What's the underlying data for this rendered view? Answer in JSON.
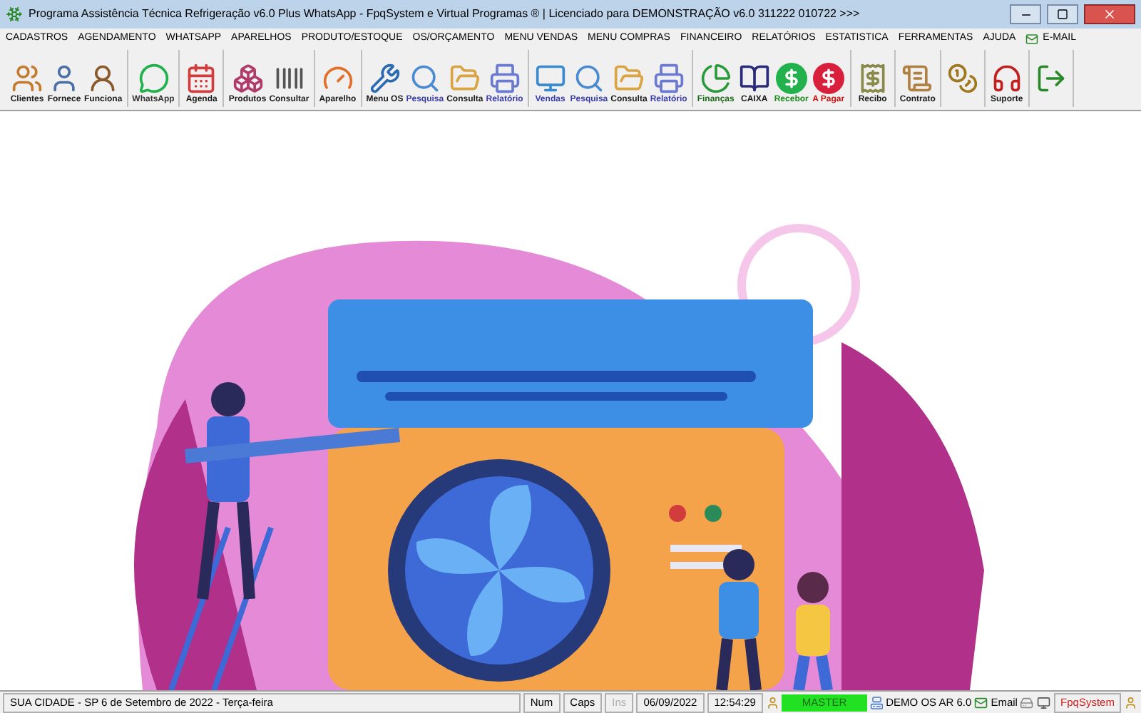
{
  "window": {
    "title": "Programa Assistência Técnica Refrigeração v6.0 Plus WhatsApp - FpqSystem e Virtual Programas ® | Licenciado para  DEMONSTRAÇÃO v6.0 311222 010722 >>>"
  },
  "menu": [
    "CADASTROS",
    "AGENDAMENTO",
    "WHATSAPP",
    "APARELHOS",
    "PRODUTO/ESTOQUE",
    "OS/ORÇAMENTO",
    "MENU VENDAS",
    "MENU COMPRAS",
    "FINANCEIRO",
    "RELATÓRIOS",
    "ESTATISTICA",
    "FERRAMENTAS",
    "AJUDA",
    "E-MAIL"
  ],
  "toolbar": [
    [
      {
        "kind": "labeled",
        "label": "Clientes",
        "color": "#1a1a1a"
      },
      {
        "kind": "labeled",
        "label": "Fornece",
        "color": "#1a1a1a"
      },
      {
        "kind": "labeled",
        "label": "Funciona",
        "color": "#1a1a1a"
      }
    ],
    [
      {
        "kind": "labeled",
        "label": "WhatsApp",
        "color": "#333333"
      }
    ],
    [
      {
        "kind": "labeled",
        "label": "Agenda",
        "color": "#1a1a1a"
      }
    ],
    [
      {
        "kind": "labeled",
        "label": "Produtos",
        "color": "#1a1a1a"
      },
      {
        "kind": "labeled",
        "label": "Consultar",
        "color": "#1a1a1a"
      }
    ],
    [
      {
        "kind": "labeled",
        "label": "Aparelho",
        "color": "#1a1a1a"
      }
    ],
    [
      {
        "kind": "labeled",
        "label": "Menu OS",
        "color": "#1a1a1a"
      },
      {
        "kind": "labeled",
        "label": "Pesquisa",
        "color": "#3a3aa8"
      },
      {
        "kind": "labeled",
        "label": "Consulta",
        "color": "#1a1a1a"
      },
      {
        "kind": "labeled",
        "label": "Relatório",
        "color": "#3a3aa8"
      }
    ],
    [
      {
        "kind": "labeled",
        "label": "Vendas",
        "color": "#3a3aa8"
      },
      {
        "kind": "labeled",
        "label": "Pesquisa",
        "color": "#3a3aa8"
      },
      {
        "kind": "labeled",
        "label": "Consulta",
        "color": "#1a1a1a"
      },
      {
        "kind": "labeled",
        "label": "Relatório",
        "color": "#3a3aa8"
      }
    ],
    [
      {
        "kind": "labeled",
        "label": "Finanças",
        "color": "#1a6a1a"
      },
      {
        "kind": "labeled",
        "label": "CAIXA",
        "color": "#1a1a1a"
      },
      {
        "kind": "labeled",
        "label": "Recebor",
        "color": "#1a8a1a"
      },
      {
        "kind": "labeled",
        "label": "A Pagar",
        "color": "#cc1111"
      }
    ],
    [
      {
        "kind": "labeled",
        "label": "Recibo",
        "color": "#1a1a1a"
      }
    ],
    [
      {
        "kind": "labeled",
        "label": "Contrato",
        "color": "#1a1a1a"
      }
    ],
    [
      {
        "kind": "icon"
      }
    ],
    [
      {
        "kind": "labeled",
        "label": "Suporte",
        "color": "#1a1a1a"
      }
    ],
    [
      {
        "kind": "icon"
      }
    ]
  ],
  "status_bar": {
    "city_date": "SUA CIDADE - SP  6 de Setembro de 2022 - Terça-feira",
    "panels": [
      {
        "text": "Num",
        "disabled": false
      },
      {
        "text": "Caps",
        "disabled": false
      },
      {
        "text": "Ins",
        "disabled": true
      },
      {
        "text": "06/09/2022",
        "disabled": false
      },
      {
        "text": "12:54:29",
        "disabled": false
      }
    ],
    "user": "MASTER",
    "system": "DEMO OS AR 6.0",
    "email": "Email",
    "brand": "FpqSystem"
  }
}
